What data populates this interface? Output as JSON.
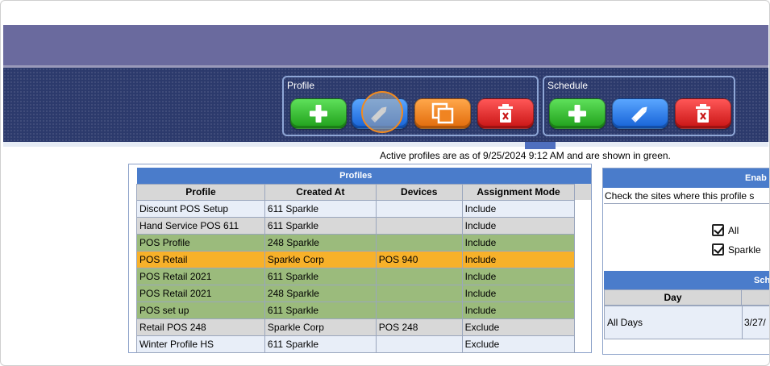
{
  "toolbar": {
    "profile_group_label": "Profile",
    "schedule_group_label": "Schedule"
  },
  "active_note": "Active profiles are as of 9/25/2024 9:12 AM and are shown in green.",
  "profiles_table": {
    "caption": "Profiles",
    "columns": [
      "Profile",
      "Created At",
      "Devices",
      "Assignment Mode"
    ],
    "rows": [
      {
        "profile": "Discount POS Setup",
        "created_at": "611 Sparkle",
        "devices": "",
        "mode": "Include",
        "state": "normal"
      },
      {
        "profile": "Hand Service POS 611",
        "created_at": "611 Sparkle",
        "devices": "",
        "mode": "Include",
        "state": "grey"
      },
      {
        "profile": "POS Profile",
        "created_at": "248 Sparkle",
        "devices": "",
        "mode": "Include",
        "state": "green"
      },
      {
        "profile": "POS Retail",
        "created_at": "Sparkle Corp",
        "devices": "POS 940",
        "mode": "Include",
        "state": "selected"
      },
      {
        "profile": "POS Retail 2021",
        "created_at": "611 Sparkle",
        "devices": "",
        "mode": "Include",
        "state": "green"
      },
      {
        "profile": "POS Retail 2021",
        "created_at": "248 Sparkle",
        "devices": "",
        "mode": "Include",
        "state": "green"
      },
      {
        "profile": "POS set up",
        "created_at": "611 Sparkle",
        "devices": "",
        "mode": "Include",
        "state": "green"
      },
      {
        "profile": "Retail POS 248",
        "created_at": "Sparkle Corp",
        "devices": "POS 248",
        "mode": "Exclude",
        "state": "grey"
      },
      {
        "profile": "Winter Profile HS",
        "created_at": "611 Sparkle",
        "devices": "",
        "mode": "Exclude",
        "state": "normal"
      }
    ]
  },
  "side_panel": {
    "header": "Enab",
    "instruction": "Check the sites where this profile s",
    "sites": [
      {
        "label": "All",
        "checked": true
      },
      {
        "label": "Sparkle",
        "checked": true
      }
    ],
    "schedule_header": "Sch",
    "schedule_columns": [
      "Day"
    ],
    "schedule_rows": [
      {
        "day": "All Days",
        "value": "3/27/"
      }
    ]
  },
  "colors": {
    "top_band": "#6a6a9e",
    "toolbar_bg": "#2c3a6c",
    "table_header": "#4a7ccb",
    "active_row": "#9bbb7c",
    "selected_row": "#f7b12a"
  },
  "icons": {
    "add": "plus-icon",
    "edit": "pencil-icon",
    "copy": "copy-icon",
    "delete": "trash-icon"
  }
}
